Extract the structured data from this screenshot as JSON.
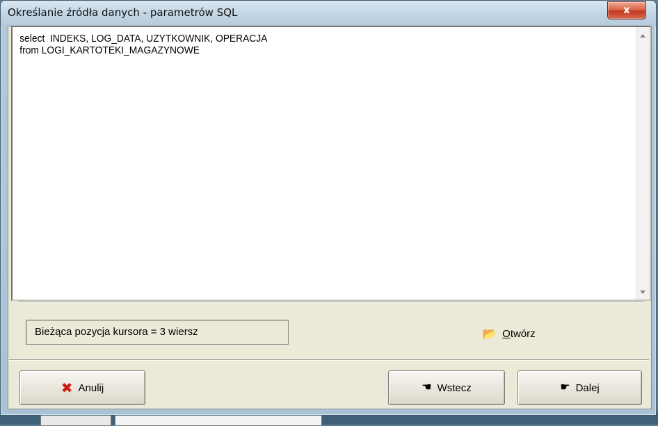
{
  "window": {
    "title": "Określanie źródła danych - parametrów SQL",
    "close_symbol": "x"
  },
  "editor": {
    "sql_text": "select  INDEKS, LOG_DATA, UZYTKOWNIK, OPERACJA\nfrom LOGI_KARTOTEKI_MAGAZYNOWE"
  },
  "status": {
    "cursor_position": "Bieżąca pozycja kursora = 3 wiersz"
  },
  "actions": {
    "open_label_mnemonic": "O",
    "open_label_rest": "twórz",
    "cancel_label": "Anulij",
    "back_label": "Wstecz",
    "next_label": "Dalej"
  },
  "icons": {
    "open": "folder-open-icon",
    "cancel": "red-x-icon",
    "back": "hand-left-icon",
    "next": "hand-right-icon"
  },
  "colors": {
    "title_bg": "#c3d6e5",
    "client_bg": "#ece9d8",
    "close_red": "#c0391f",
    "cancel_red": "#cc1a0e"
  }
}
